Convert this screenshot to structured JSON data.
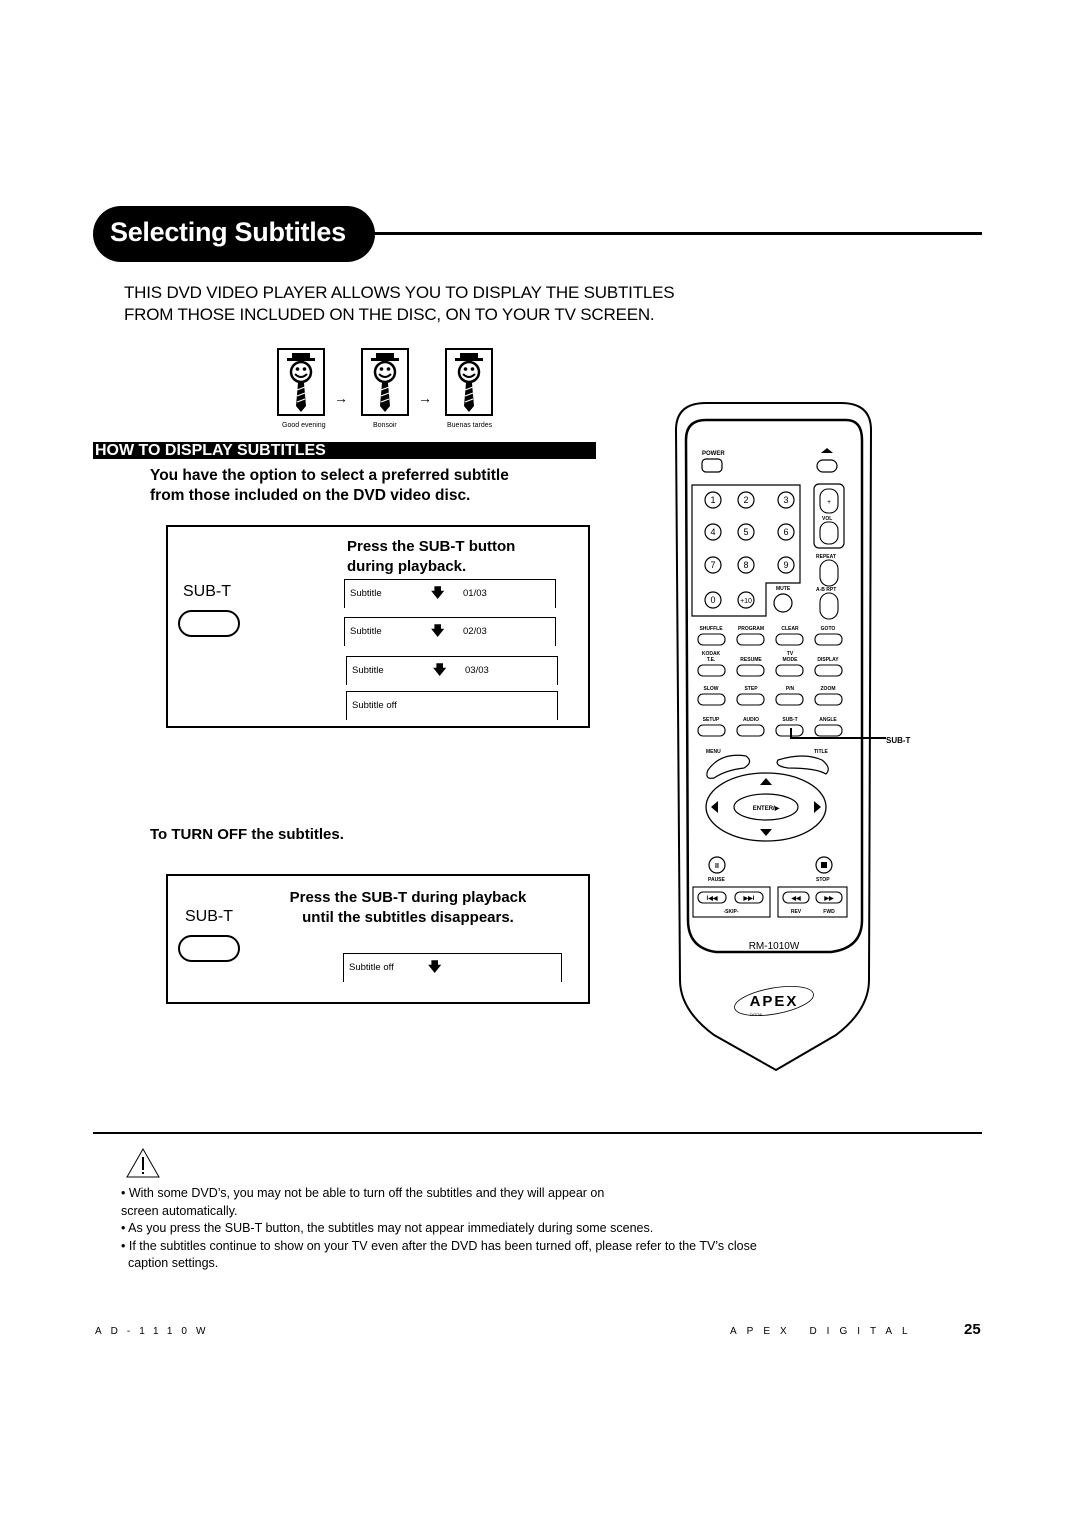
{
  "page": {
    "title": "Selecting Subtitles",
    "intro_lines": [
      "THIS DVD VIDEO PLAYER ALLOWS YOU TO DISPLAY THE SUBTITLES",
      "FROM THOSE INCLUDED ON THE DISC, ON TO YOUR TV SCREEN."
    ]
  },
  "illustration": {
    "captions": [
      "Good evening",
      "Bonsoir",
      "Buenas tardes"
    ],
    "arrow": "→"
  },
  "section": {
    "heading": "HOW TO DISPLAY SUBTITLES",
    "lead_lines": [
      "You have the option to select a preferred subtitle",
      "from those included on the DVD video disc."
    ]
  },
  "step1": {
    "button_label": "SUB-T",
    "instruction_lines": [
      "Press the SUB-T button",
      "during playback."
    ],
    "osd": [
      {
        "label": "Subtitle",
        "arrow": "🡇",
        "value": "01/03"
      },
      {
        "label": "Subtitle",
        "arrow": "🡇",
        "value": "02/03"
      },
      {
        "label": "Subtitle",
        "arrow": "🡇",
        "value": "03/03"
      },
      {
        "label": "Subtitle  off",
        "arrow": "",
        "value": ""
      }
    ]
  },
  "turn_off": {
    "heading": "To TURN OFF the subtitles.",
    "button_label": "SUB-T",
    "instruction_lines": [
      "Press the SUB-T during playback",
      "until the subtitles disappears."
    ],
    "osd": {
      "label": "Subtitle  off",
      "arrow": "🡇"
    }
  },
  "remote": {
    "model": "RM-1010W",
    "brand": "APEX",
    "brand_sub": "DIGITAL",
    "callout": "SUB-T",
    "top_labels": {
      "power": "POWER",
      "vol": "VOL",
      "repeat": "REPEAT",
      "ab_rpt": "A-B RPT",
      "mute": "MUTE"
    },
    "digits": [
      "1",
      "2",
      "3",
      "4",
      "5",
      "6",
      "7",
      "8",
      "9",
      "0",
      "+10"
    ],
    "button_rows": [
      [
        "SHUFFLE",
        "PROGRAM",
        "CLEAR",
        "GOTO"
      ],
      [
        "KODAK T.E.",
        "RESUME",
        "TV MODE",
        "DISPLAY"
      ],
      [
        "SLOW",
        "STEP",
        "P/N",
        "ZOOM"
      ],
      [
        "SETUP",
        "AUDIO",
        "SUB-T",
        "ANGLE"
      ]
    ],
    "nav": {
      "menu": "MENU",
      "title": "TITLE",
      "enter": "ENTER/▶"
    },
    "transport": {
      "pause": "PAUSE",
      "stop": "STOP",
      "skip": "-SKIP-",
      "rev": "REV",
      "fwd": "FWD"
    }
  },
  "notes": [
    "• With some DVD’s, you may not be able to turn off the subtitles and they will appear on",
    "screen automatically.",
    "• As you press the SUB-T  button, the subtitles may not appear immediately during some scenes.",
    "• If the subtitles continue to show on your TV even after the DVD has been turned off, please refer to the TV’s close",
    "  caption settings."
  ],
  "footer": {
    "model": "AD-1110W",
    "brand": "APEX DIGITAL",
    "page_number": "25"
  }
}
